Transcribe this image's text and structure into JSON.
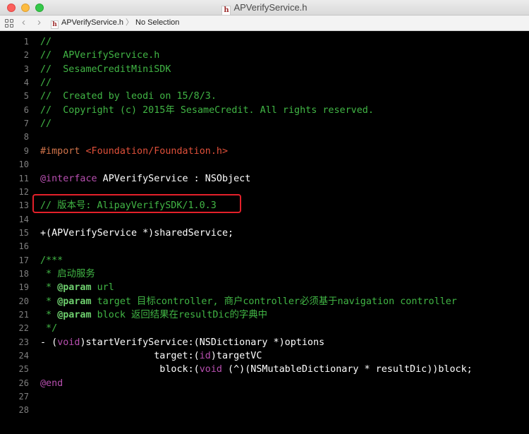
{
  "window": {
    "title": "APVerifyService.h",
    "file_icon_glyph": "h"
  },
  "jumpbar": {
    "grid_icon": "related-items-grid-icon",
    "back_glyph": "‹",
    "forward_glyph": "›",
    "file_name": "APVerifyService.h",
    "separator": "〉",
    "selection": "No Selection"
  },
  "colors": {
    "comment": "#41b645",
    "preprocessor": "#d0734a",
    "string": "#e0503a",
    "keyword": "#b84fb0",
    "highlight_box": "#e3202a"
  },
  "code_lines": [
    {
      "n": "1",
      "parts": [
        {
          "c": "c-comment",
          "t": "//"
        }
      ]
    },
    {
      "n": "2",
      "parts": [
        {
          "c": "c-comment",
          "t": "//  APVerifyService.h"
        }
      ]
    },
    {
      "n": "3",
      "parts": [
        {
          "c": "c-comment",
          "t": "//  SesameCreditMiniSDK"
        }
      ]
    },
    {
      "n": "4",
      "parts": [
        {
          "c": "c-comment",
          "t": "//"
        }
      ]
    },
    {
      "n": "5",
      "parts": [
        {
          "c": "c-comment",
          "t": "//  Created by leodi on 15/8/3."
        }
      ]
    },
    {
      "n": "6",
      "parts": [
        {
          "c": "c-comment",
          "t": "//  Copyright (c) 2015年 SesameCredit. All rights reserved."
        }
      ]
    },
    {
      "n": "7",
      "parts": [
        {
          "c": "c-comment",
          "t": "//"
        }
      ]
    },
    {
      "n": "8",
      "parts": []
    },
    {
      "n": "9",
      "parts": [
        {
          "c": "c-pre",
          "t": "#import "
        },
        {
          "c": "c-str",
          "t": "<Foundation/Foundation.h>"
        }
      ]
    },
    {
      "n": "10",
      "parts": []
    },
    {
      "n": "11",
      "parts": [
        {
          "c": "c-kw",
          "t": "@interface"
        },
        {
          "c": "c-white",
          "t": " APVerifyService : NSObject"
        }
      ]
    },
    {
      "n": "12",
      "parts": []
    },
    {
      "n": "13",
      "parts": [
        {
          "c": "c-comment",
          "t": "// 版本号: AlipayVerifySDK/1.0.3"
        }
      ]
    },
    {
      "n": "14",
      "parts": []
    },
    {
      "n": "15",
      "parts": [
        {
          "c": "c-white",
          "t": "+(APVerifyService *)sharedService;"
        }
      ]
    },
    {
      "n": "16",
      "parts": []
    },
    {
      "n": "17",
      "parts": [
        {
          "c": "c-comment",
          "t": "/***"
        }
      ]
    },
    {
      "n": "18",
      "parts": [
        {
          "c": "c-comment",
          "t": " * 启动服务"
        }
      ]
    },
    {
      "n": "19",
      "parts": [
        {
          "c": "c-comment",
          "t": " * "
        },
        {
          "c": "c-docb",
          "t": "@param"
        },
        {
          "c": "c-comment",
          "t": " url"
        }
      ]
    },
    {
      "n": "20",
      "parts": [
        {
          "c": "c-comment",
          "t": " * "
        },
        {
          "c": "c-docb",
          "t": "@param"
        },
        {
          "c": "c-comment",
          "t": " target 目标controller, 商户controller必须基于navigation controller"
        }
      ]
    },
    {
      "n": "21",
      "parts": [
        {
          "c": "c-comment",
          "t": " * "
        },
        {
          "c": "c-docb",
          "t": "@param"
        },
        {
          "c": "c-comment",
          "t": " block 返回结果在resultDic的字典中"
        }
      ]
    },
    {
      "n": "22",
      "parts": [
        {
          "c": "c-comment",
          "t": " */"
        }
      ]
    },
    {
      "n": "23",
      "parts": [
        {
          "c": "c-white",
          "t": "- ("
        },
        {
          "c": "c-kw",
          "t": "void"
        },
        {
          "c": "c-white",
          "t": ")startVerifyService:(NSDictionary *)options"
        }
      ]
    },
    {
      "n": "24",
      "parts": [
        {
          "c": "c-white",
          "t": "                    target:("
        },
        {
          "c": "c-kw",
          "t": "id"
        },
        {
          "c": "c-white",
          "t": ")targetVC"
        }
      ]
    },
    {
      "n": "25",
      "parts": [
        {
          "c": "c-white",
          "t": "                     block:("
        },
        {
          "c": "c-kw",
          "t": "void"
        },
        {
          "c": "c-white",
          "t": " (^)(NSMutableDictionary * resultDic))block;"
        }
      ]
    },
    {
      "n": "26",
      "parts": [
        {
          "c": "c-kw",
          "t": "@end"
        }
      ]
    },
    {
      "n": "27",
      "parts": []
    },
    {
      "n": "28",
      "parts": []
    }
  ]
}
